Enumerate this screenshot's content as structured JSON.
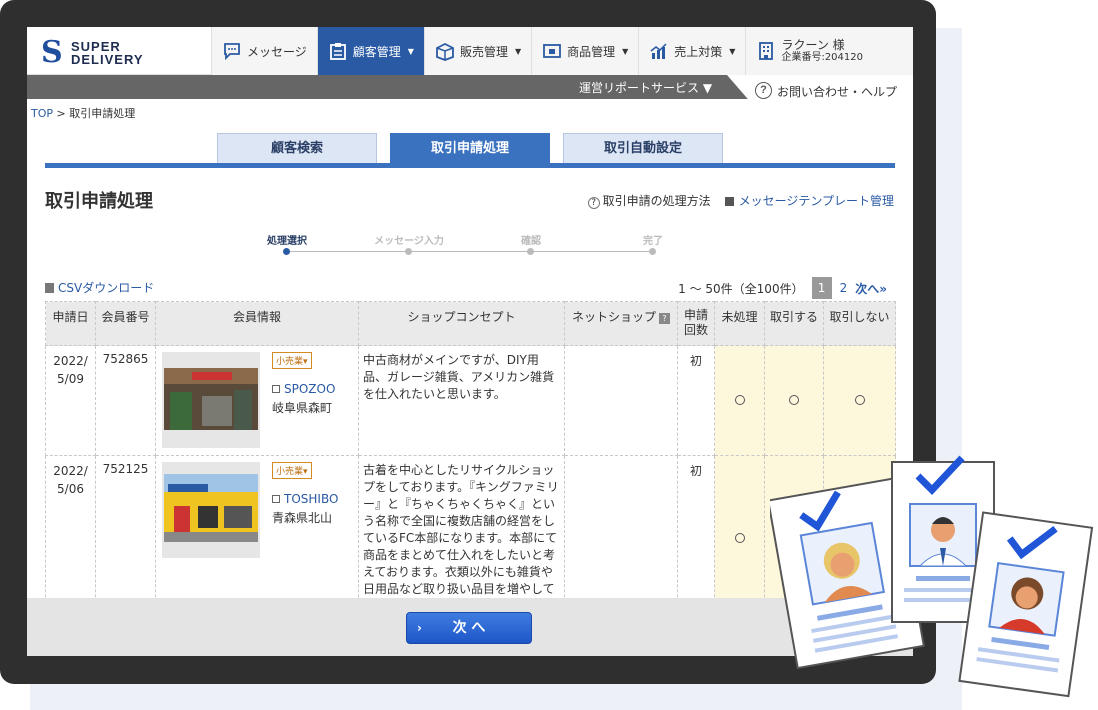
{
  "logo": {
    "mark": "S",
    "line1": "SUPER",
    "line2": "DELIVERY"
  },
  "nav": {
    "message": "メッセージ",
    "customer": "顧客管理",
    "sales": "販売管理",
    "products": "商品管理",
    "marketing": "売上対策",
    "user_name": "ラクーン 様",
    "company_no": "企業番号:204120"
  },
  "subbar": {
    "service": "運営リポートサービス ▼",
    "help": "お問い合わせ・ヘルプ",
    "help_icon": "?"
  },
  "breadcrumb": {
    "top": "TOP",
    "sep": " > ",
    "current": "取引申請処理"
  },
  "tabs": [
    "顧客検索",
    "取引申請処理",
    "取引自動設定"
  ],
  "page": {
    "title": "取引申請処理",
    "link_howto": "取引申請の処理方法",
    "link_template": "メッセージテンプレート管理"
  },
  "steps": [
    "処理選択",
    "メッセージ入力",
    "確認",
    "完了"
  ],
  "csv": "CSVダウンロード",
  "pager": {
    "range": "1 ～ 50件（全100件）",
    "current": "1",
    "page2": "2",
    "next": "次へ»"
  },
  "table": {
    "headers": [
      "申請日",
      "会員番号",
      "会員情報",
      "ショップコンセプト",
      "ネットショップ",
      "申請\n回数",
      "未処理",
      "取引する",
      "取引しない"
    ],
    "net_help": "?",
    "rows": [
      {
        "date": "2022/\n5/09",
        "member_no": "752865",
        "tag": "小売業▾",
        "shop": "SPOZOO",
        "location": "岐阜県森町",
        "concept": "中古商材がメインですが、DIY用品、ガレージ雑貨、アメリカン雑貨を仕入れたいと思います。",
        "count": "初"
      },
      {
        "date": "2022/\n5/06",
        "member_no": "752125",
        "tag": "小売業▾",
        "shop": "TOSHIBO",
        "location": "青森県北山",
        "concept": "古着を中心としたリサイクルショップをしております。『キングファミリー』と『ちゃくちゃくちゃく』という名称で全国に複数店舗の経営をしているFC本部になります。本部にて商品をまとめて仕入れをしたいと考えております。衣類以外にも雑貨や日用品など取り扱い品目を増やしていきたいと思っております。",
        "count": "初"
      }
    ]
  },
  "footer": {
    "next_button": "次 へ",
    "chevron": "›"
  },
  "colors": {
    "brand": "#2a5aa4",
    "accent": "#3a72bf",
    "pending_bg": "#fdf7dc",
    "dark_bar": "#666666"
  }
}
